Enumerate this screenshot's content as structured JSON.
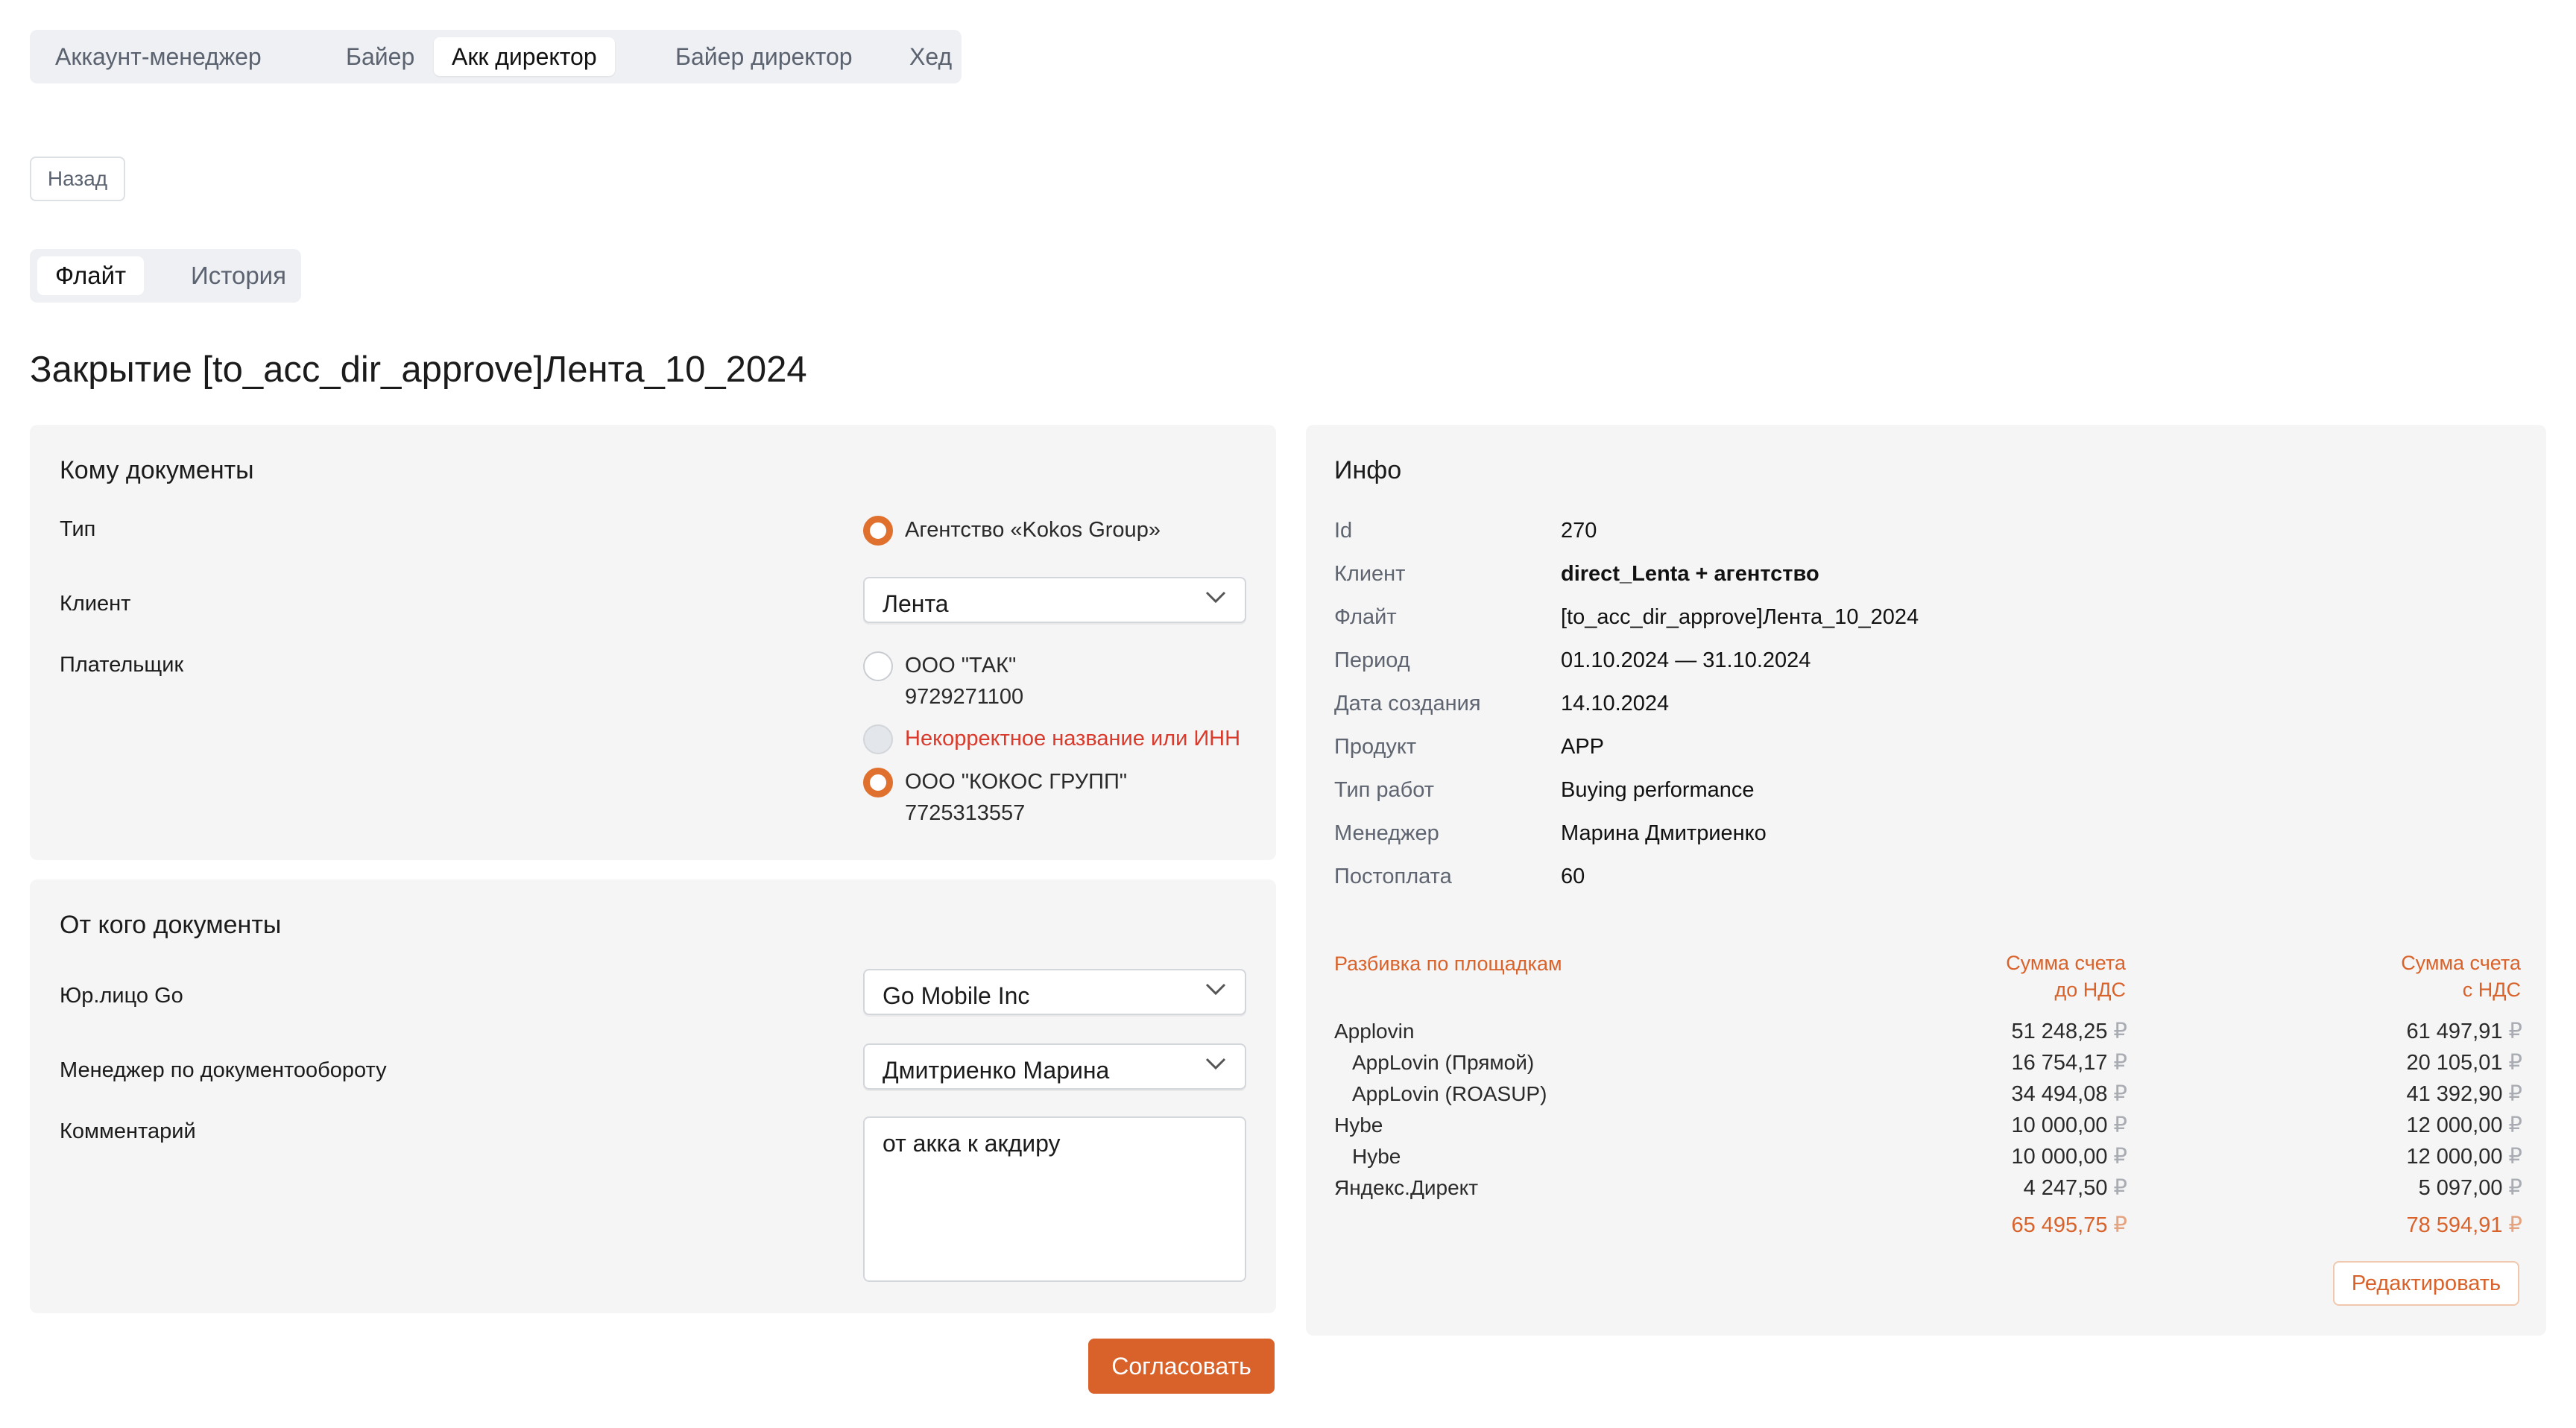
{
  "role_tabs": [
    {
      "label": "Аккаунт-менеджер",
      "active": false
    },
    {
      "label": "Байер",
      "active": false
    },
    {
      "label": "Акк директор",
      "active": true
    },
    {
      "label": "Байер директор",
      "active": false
    },
    {
      "label": "Хед",
      "active": false
    }
  ],
  "back_label": "Назад",
  "sub_tabs": [
    {
      "label": "Флайт",
      "active": true
    },
    {
      "label": "История",
      "active": false
    }
  ],
  "page_title": "Закрытие [to_acc_dir_approve]Лента_10_2024",
  "to_docs": {
    "title": "Кому документы",
    "type_label": "Тип",
    "type_option": "Агентство «Kokos Group»",
    "client_label": "Клиент",
    "client_value": "Лента",
    "payer_label": "Плательщик",
    "payers": [
      {
        "name": "ООО \"ТАК\"",
        "inn": "9729271100",
        "state": "unchecked"
      },
      {
        "name": "Некорректное название или ИНН",
        "inn": "",
        "state": "disabled"
      },
      {
        "name": "ООО \"КОКОС ГРУПП\"",
        "inn": "7725313557",
        "state": "checked"
      }
    ]
  },
  "from_docs": {
    "title": "От кого документы",
    "legal_label": "Юр.лицо Go",
    "legal_value": "Go Mobile Inc",
    "manager_label": "Менеджер по документообороту",
    "manager_value": "Дмитриенко Марина",
    "comment_label": "Комментарий",
    "comment_value": "от акка к акдиру"
  },
  "approve_label": "Согласовать",
  "info": {
    "title": "Инфо",
    "rows": [
      {
        "key": "Id",
        "value": "270"
      },
      {
        "key": "Клиент",
        "value": "direct_Lenta + агентство"
      },
      {
        "key": "Флайт",
        "value": "[to_acc_dir_approve]Лента_10_2024"
      },
      {
        "key": "Период",
        "value": "01.10.2024 — 31.10.2024"
      },
      {
        "key": "Дата создания",
        "value": "14.10.2024"
      },
      {
        "key": "Продукт",
        "value": "APP"
      },
      {
        "key": "Тип работ",
        "value": "Buying performance"
      },
      {
        "key": "Менеджер",
        "value": "Марина Дмитриенко"
      },
      {
        "key": "Постоплата",
        "value": "60"
      }
    ],
    "breakdown": {
      "col1": "Разбивка по площадкам",
      "col2_line1": "Сумма счета",
      "col2_line2": "до НДС",
      "col3_line1": "Сумма счета",
      "col3_line2": "с НДС",
      "currency": "₽",
      "rows": [
        {
          "name": "Applovin",
          "indent": false,
          "net": "51 248,25",
          "gross": "61 497,91"
        },
        {
          "name": "AppLovin (Прямой)",
          "indent": true,
          "net": "16 754,17",
          "gross": "20 105,01"
        },
        {
          "name": "AppLovin (ROASUP)",
          "indent": true,
          "net": "34 494,08",
          "gross": "41 392,90"
        },
        {
          "name": "Hybe",
          "indent": false,
          "net": "10 000,00",
          "gross": "12 000,00"
        },
        {
          "name": "Hybe",
          "indent": true,
          "net": "10 000,00",
          "gross": "12 000,00"
        },
        {
          "name": "Яндекс.Директ",
          "indent": false,
          "net": "4 247,50",
          "gross": "5 097,00"
        }
      ],
      "total_net": "65 495,75",
      "total_gross": "78 594,91"
    },
    "edit_label": "Редактировать"
  }
}
